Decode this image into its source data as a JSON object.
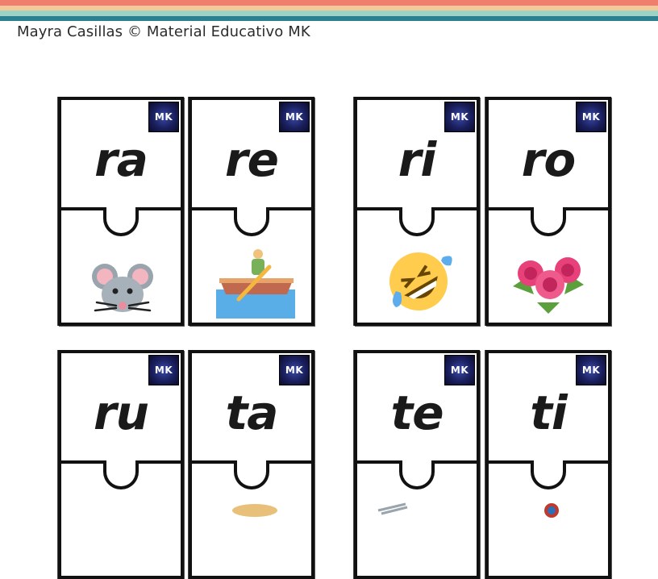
{
  "header": {
    "credit": "Mayra Casillas © Material Educativo MK",
    "stripes": [
      "#f07e6e",
      "#f4c99a",
      "#9dd2c6",
      "#2c7f8e"
    ]
  },
  "logo_text": "MK",
  "pieces": [
    {
      "syllable": "ra",
      "picture": "mouse-face"
    },
    {
      "syllable": "re",
      "picture": "person-rowing-boat"
    },
    {
      "syllable": "ri",
      "picture": "rolling-on-floor-laughing-face"
    },
    {
      "syllable": "ro",
      "picture": "pink-roses"
    },
    {
      "syllable": "ru",
      "picture": ""
    },
    {
      "syllable": "ta",
      "picture": "cup-partially-visible"
    },
    {
      "syllable": "te",
      "picture": "partially-visible"
    },
    {
      "syllable": "ti",
      "picture": "partially-visible"
    }
  ]
}
